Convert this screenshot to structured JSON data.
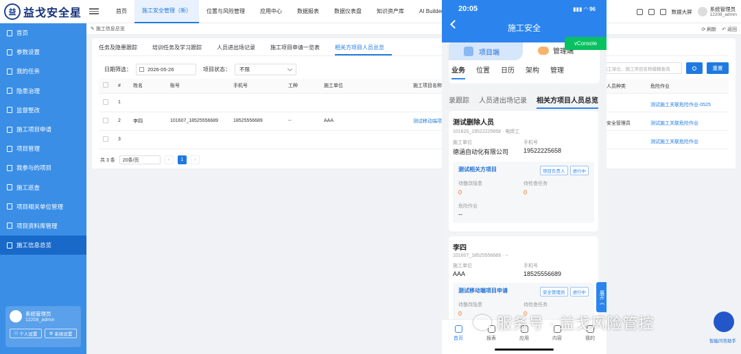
{
  "brand": {
    "name": "益戈安全星",
    "mark": "益"
  },
  "sidebar": {
    "items": [
      {
        "label": "首页"
      },
      {
        "label": "参数设置"
      },
      {
        "label": "我的任务"
      },
      {
        "label": "隐患治理"
      },
      {
        "label": "监督整改"
      },
      {
        "label": "施工项目申请"
      },
      {
        "label": "项目管理"
      },
      {
        "label": "我参与的项目"
      },
      {
        "label": "施工巡查"
      },
      {
        "label": "项目相关单位管理"
      },
      {
        "label": "项目资料库管理"
      },
      {
        "label": "施工信息总览"
      }
    ],
    "user": {
      "name": "系统管理员",
      "account": "12208_admin",
      "personal_btn": "个人设置",
      "system_btn": "系统设置"
    }
  },
  "topnav": {
    "items": [
      "首页",
      "施工安全管理（新）",
      "位置与风险管理",
      "应用中心",
      "数据报表",
      "数据仪表盘",
      "知识资产库",
      "AI Builder"
    ],
    "big_screen": "数据大屏",
    "user_name": "系统管理员",
    "user_account": "12208_admin"
  },
  "crumb": {
    "label": "施工信息总览",
    "refresh": "刷新",
    "back": "返回"
  },
  "tabs": [
    "任务及隐患跟踪",
    "培训任务及学习跟踪",
    "人员进出场记录",
    "施工项目申请一览表",
    "相关方项目人员总览"
  ],
  "filters": {
    "date_label": "日期筛选：",
    "date_value": "2026-05-26",
    "status_label": "项目状态：",
    "status_value": "不限",
    "search_placeholder": "施工单位、施工项目名称模糊查询",
    "reset": "重置"
  },
  "table": {
    "headers": [
      "#",
      "姓名",
      "账号",
      "手机号",
      "工种",
      "施工单位",
      "施工项目名称"
    ],
    "rows": [
      {
        "idx": "1",
        "name": "",
        "account": "",
        "phone": "",
        "trade": "",
        "unit": "",
        "project": "",
        "role": "",
        "danger": "测试施工关联危险作业-0525"
      },
      {
        "idx": "2",
        "name": "李四",
        "account": "101607_18525556689",
        "phone": "18525556689",
        "trade": "--",
        "unit": "AAA",
        "project": "测试移动端项目",
        "role": "安全管理员",
        "danger": "测试施工关联危险作业"
      },
      {
        "idx": "3",
        "name": "",
        "account": "",
        "phone": "",
        "trade": "",
        "unit": "",
        "project": "",
        "role": "",
        "danger": "测试施工关联危险作业"
      }
    ],
    "right_headers": [
      "人员种类",
      "危险作业"
    ]
  },
  "pager": {
    "total": "共 3 条",
    "size": "20条/页",
    "page": "1"
  },
  "phone": {
    "time": "20:05",
    "signal": "96",
    "title": "施工安全",
    "vconsole": "vConsole",
    "switch_left": "项目端",
    "switch_right": "管理端",
    "subtabs": [
      "业务",
      "位置",
      "日历",
      "架构",
      "管理"
    ],
    "tabs2": [
      "录跟踪",
      "人员进出场记录",
      "相关方项目人员总览"
    ],
    "cards": [
      {
        "name": "测试删除人员",
        "sub": "101620_19522225658 · 电焊工",
        "unit_label": "施工单位",
        "unit": "德涵自动化有限公司",
        "phone_label": "手机号",
        "phone": "19522225658",
        "project": "测试相关方项目",
        "tag1": "项目负责人",
        "tag2": "进行中",
        "hazard_label": "待整改隐患",
        "hazard": "0",
        "task_label": "待检查任务",
        "task": "0",
        "danger_label": "危险作业",
        "danger": "--"
      },
      {
        "name": "李四",
        "sub": "101607_18525556689 · --",
        "unit_label": "施工单位",
        "unit": "AAA",
        "phone_label": "手机号",
        "phone": "18525556689",
        "project": "测试移动端项目申请",
        "tag1": "安全管理员",
        "tag2": "进行中",
        "hazard_label": "待整改隐患",
        "hazard": "0",
        "task_label": "待检查任务",
        "task": "0"
      }
    ],
    "expand": "展开《",
    "tabbar": [
      "首页",
      "报表",
      "应用",
      "内容",
      "我的"
    ]
  },
  "watermark": "服务号 · 益戈风险管控",
  "robot_label": "智能问答助手",
  "colors": {
    "sidebar": "#3a8ee6",
    "accent": "#1f7ae0",
    "phone_header": "#2b84ee"
  }
}
